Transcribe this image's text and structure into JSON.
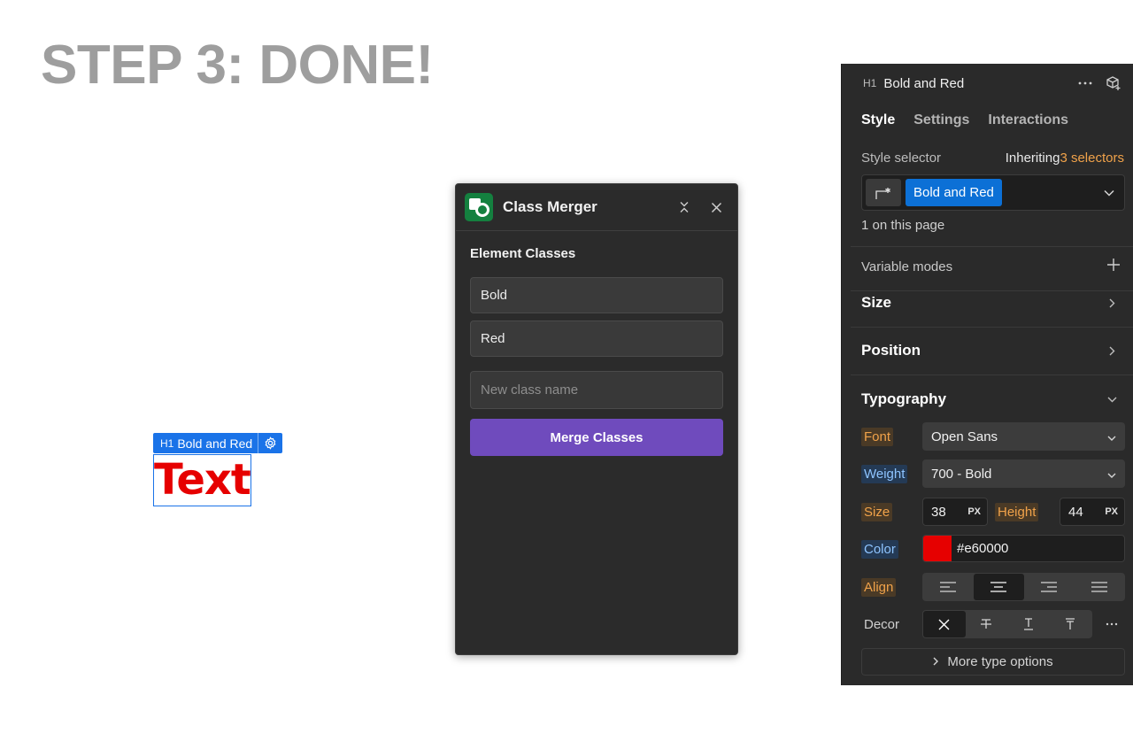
{
  "page": {
    "title": "STEP 3: DONE!"
  },
  "canvas": {
    "element_tag": "H1",
    "element_class": "Bold and Red",
    "element_text": "Text"
  },
  "modal": {
    "title": "Class Merger",
    "section_label": "Element Classes",
    "classes": [
      "Bold",
      "Red"
    ],
    "new_class_placeholder": "New class name",
    "merge_button_label": "Merge Classes",
    "icons": [
      "app-logo-icon",
      "collapse-icon",
      "close-icon"
    ]
  },
  "panel": {
    "element_tag": "H1",
    "element_name": "Bold and Red",
    "tabs": [
      "Style",
      "Settings",
      "Interactions"
    ],
    "active_tab": "Style",
    "style_selector_label": "Style selector",
    "inheriting_label": "Inheriting",
    "inheriting_count": "3 selectors",
    "selector_chip": "Bold and Red",
    "on_page": "1 on this page",
    "variable_modes": "Variable modes",
    "sections": {
      "size": "Size",
      "position": "Position",
      "typography": "Typography"
    },
    "typography": {
      "font_label": "Font",
      "font_value": "Open Sans",
      "weight_label": "Weight",
      "weight_value": "700 - Bold",
      "size_label": "Size",
      "size_value": "38",
      "size_unit": "PX",
      "height_label": "Height",
      "height_value": "44",
      "height_unit": "PX",
      "color_label": "Color",
      "color_value": "#e60000",
      "align_label": "Align",
      "align_options": [
        "left",
        "center",
        "right",
        "justify"
      ],
      "align_selected": "center",
      "decor_label": "Decor",
      "decor_options": [
        "none",
        "strikethrough",
        "underline",
        "overline"
      ],
      "decor_selected": "none",
      "more_options": "More type options"
    },
    "colors": {
      "accent_blue": "#0c70d6",
      "inherited_orange": "#f0a24a",
      "set_blue": "#8ec4ff",
      "text_red": "#e60000",
      "merge_purple": "#6f4bbd"
    }
  }
}
